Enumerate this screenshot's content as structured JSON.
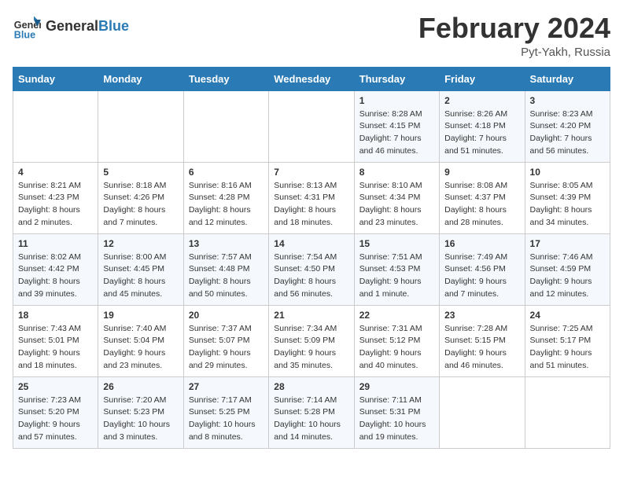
{
  "header": {
    "logo_general": "General",
    "logo_blue": "Blue",
    "month_year": "February 2024",
    "location": "Pyt-Yakh, Russia"
  },
  "days_of_week": [
    "Sunday",
    "Monday",
    "Tuesday",
    "Wednesday",
    "Thursday",
    "Friday",
    "Saturday"
  ],
  "weeks": [
    [
      {
        "day": "",
        "text": ""
      },
      {
        "day": "",
        "text": ""
      },
      {
        "day": "",
        "text": ""
      },
      {
        "day": "",
        "text": ""
      },
      {
        "day": "1",
        "text": "Sunrise: 8:28 AM\nSunset: 4:15 PM\nDaylight: 7 hours\nand 46 minutes."
      },
      {
        "day": "2",
        "text": "Sunrise: 8:26 AM\nSunset: 4:18 PM\nDaylight: 7 hours\nand 51 minutes."
      },
      {
        "day": "3",
        "text": "Sunrise: 8:23 AM\nSunset: 4:20 PM\nDaylight: 7 hours\nand 56 minutes."
      }
    ],
    [
      {
        "day": "4",
        "text": "Sunrise: 8:21 AM\nSunset: 4:23 PM\nDaylight: 8 hours\nand 2 minutes."
      },
      {
        "day": "5",
        "text": "Sunrise: 8:18 AM\nSunset: 4:26 PM\nDaylight: 8 hours\nand 7 minutes."
      },
      {
        "day": "6",
        "text": "Sunrise: 8:16 AM\nSunset: 4:28 PM\nDaylight: 8 hours\nand 12 minutes."
      },
      {
        "day": "7",
        "text": "Sunrise: 8:13 AM\nSunset: 4:31 PM\nDaylight: 8 hours\nand 18 minutes."
      },
      {
        "day": "8",
        "text": "Sunrise: 8:10 AM\nSunset: 4:34 PM\nDaylight: 8 hours\nand 23 minutes."
      },
      {
        "day": "9",
        "text": "Sunrise: 8:08 AM\nSunset: 4:37 PM\nDaylight: 8 hours\nand 28 minutes."
      },
      {
        "day": "10",
        "text": "Sunrise: 8:05 AM\nSunset: 4:39 PM\nDaylight: 8 hours\nand 34 minutes."
      }
    ],
    [
      {
        "day": "11",
        "text": "Sunrise: 8:02 AM\nSunset: 4:42 PM\nDaylight: 8 hours\nand 39 minutes."
      },
      {
        "day": "12",
        "text": "Sunrise: 8:00 AM\nSunset: 4:45 PM\nDaylight: 8 hours\nand 45 minutes."
      },
      {
        "day": "13",
        "text": "Sunrise: 7:57 AM\nSunset: 4:48 PM\nDaylight: 8 hours\nand 50 minutes."
      },
      {
        "day": "14",
        "text": "Sunrise: 7:54 AM\nSunset: 4:50 PM\nDaylight: 8 hours\nand 56 minutes."
      },
      {
        "day": "15",
        "text": "Sunrise: 7:51 AM\nSunset: 4:53 PM\nDaylight: 9 hours\nand 1 minute."
      },
      {
        "day": "16",
        "text": "Sunrise: 7:49 AM\nSunset: 4:56 PM\nDaylight: 9 hours\nand 7 minutes."
      },
      {
        "day": "17",
        "text": "Sunrise: 7:46 AM\nSunset: 4:59 PM\nDaylight: 9 hours\nand 12 minutes."
      }
    ],
    [
      {
        "day": "18",
        "text": "Sunrise: 7:43 AM\nSunset: 5:01 PM\nDaylight: 9 hours\nand 18 minutes."
      },
      {
        "day": "19",
        "text": "Sunrise: 7:40 AM\nSunset: 5:04 PM\nDaylight: 9 hours\nand 23 minutes."
      },
      {
        "day": "20",
        "text": "Sunrise: 7:37 AM\nSunset: 5:07 PM\nDaylight: 9 hours\nand 29 minutes."
      },
      {
        "day": "21",
        "text": "Sunrise: 7:34 AM\nSunset: 5:09 PM\nDaylight: 9 hours\nand 35 minutes."
      },
      {
        "day": "22",
        "text": "Sunrise: 7:31 AM\nSunset: 5:12 PM\nDaylight: 9 hours\nand 40 minutes."
      },
      {
        "day": "23",
        "text": "Sunrise: 7:28 AM\nSunset: 5:15 PM\nDaylight: 9 hours\nand 46 minutes."
      },
      {
        "day": "24",
        "text": "Sunrise: 7:25 AM\nSunset: 5:17 PM\nDaylight: 9 hours\nand 51 minutes."
      }
    ],
    [
      {
        "day": "25",
        "text": "Sunrise: 7:23 AM\nSunset: 5:20 PM\nDaylight: 9 hours\nand 57 minutes."
      },
      {
        "day": "26",
        "text": "Sunrise: 7:20 AM\nSunset: 5:23 PM\nDaylight: 10 hours\nand 3 minutes."
      },
      {
        "day": "27",
        "text": "Sunrise: 7:17 AM\nSunset: 5:25 PM\nDaylight: 10 hours\nand 8 minutes."
      },
      {
        "day": "28",
        "text": "Sunrise: 7:14 AM\nSunset: 5:28 PM\nDaylight: 10 hours\nand 14 minutes."
      },
      {
        "day": "29",
        "text": "Sunrise: 7:11 AM\nSunset: 5:31 PM\nDaylight: 10 hours\nand 19 minutes."
      },
      {
        "day": "",
        "text": ""
      },
      {
        "day": "",
        "text": ""
      }
    ]
  ]
}
